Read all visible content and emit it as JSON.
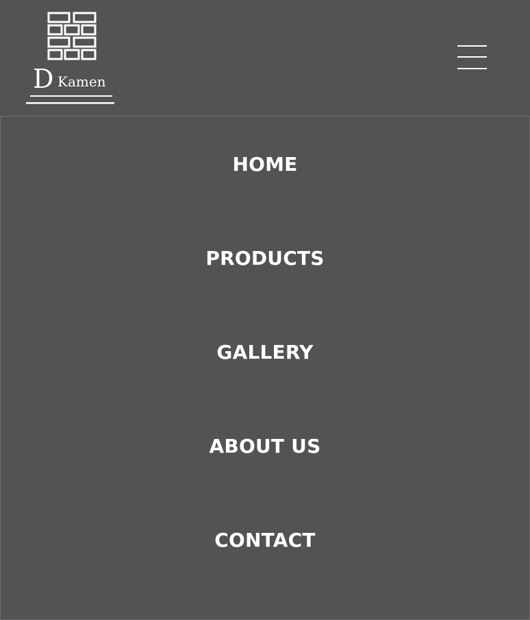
{
  "brand": {
    "name_initial": "D",
    "name_rest": "Kamen"
  },
  "header": {
    "menu_icon": "hamburger-menu-icon"
  },
  "nav": {
    "items": [
      {
        "label": "HOME"
      },
      {
        "label": "PRODUCTS"
      },
      {
        "label": "GALLERY"
      },
      {
        "label": "ABOUT US"
      },
      {
        "label": "CONTACT"
      }
    ]
  },
  "colors": {
    "background": "#535353",
    "text": "#ffffff"
  }
}
